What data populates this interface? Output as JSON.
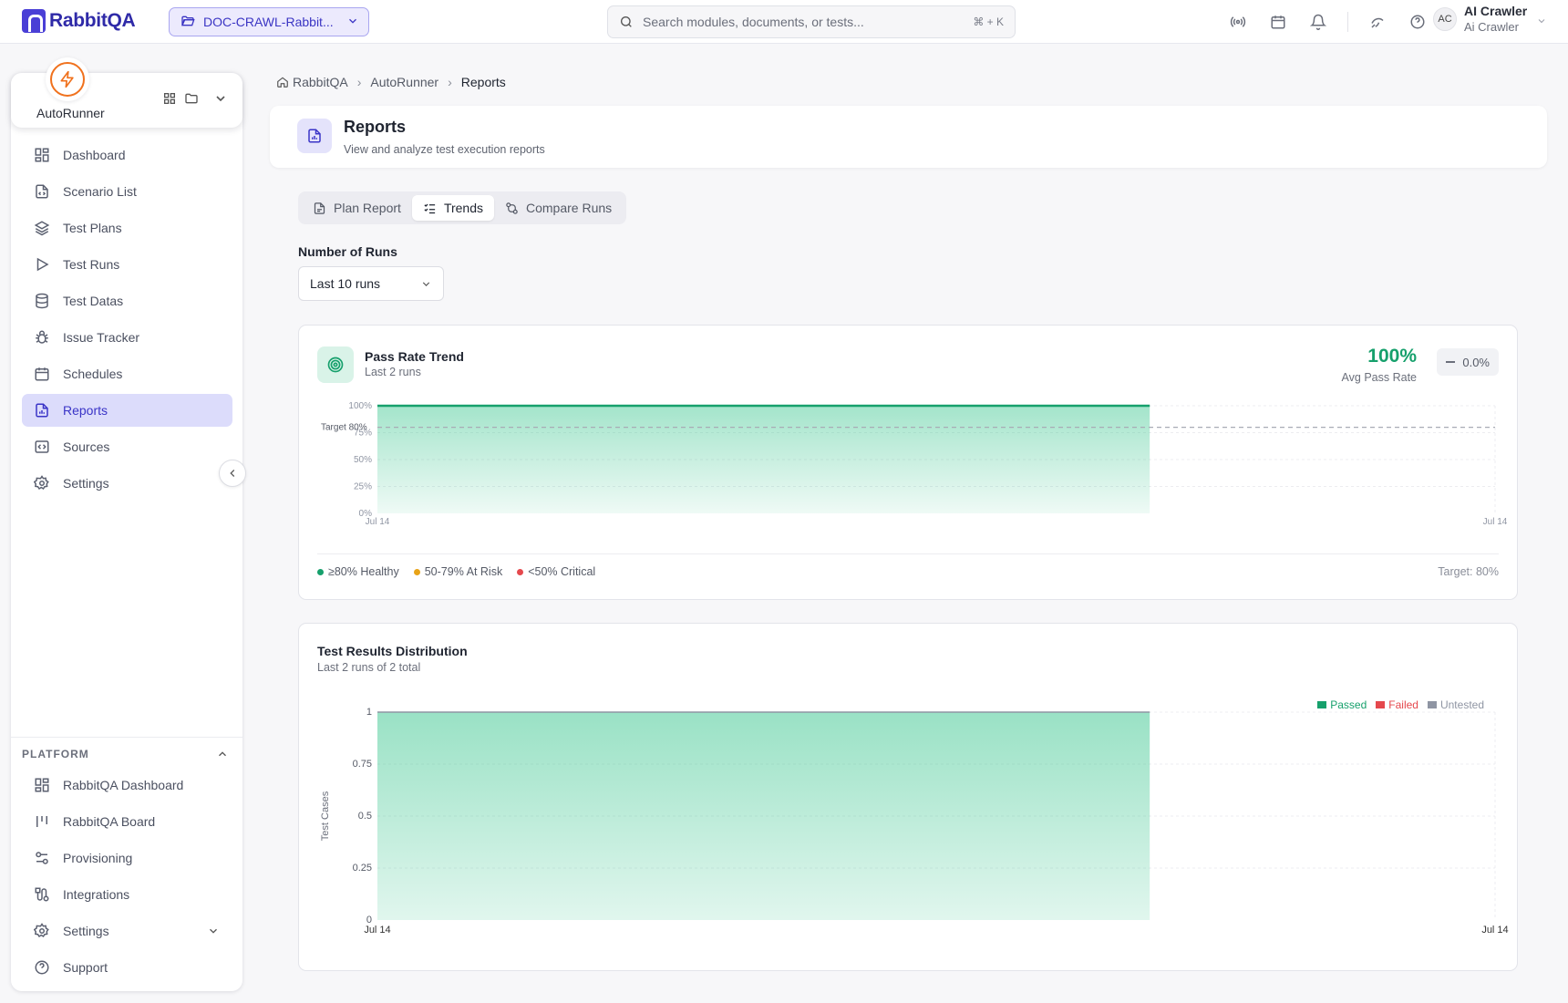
{
  "app": {
    "brand": "RabbitQA",
    "project": "DOC-CRAWL-Rabbit..."
  },
  "search": {
    "placeholder": "Search modules, documents, or tests...",
    "shortcut": "⌘ + K"
  },
  "user": {
    "initials": "AC",
    "name": "AI Crawler",
    "subtitle": "Ai Crawler"
  },
  "sidebar": {
    "app_name": "AutoRunner",
    "items": [
      {
        "label": "Dashboard",
        "icon": "dashboard-icon"
      },
      {
        "label": "Scenario List",
        "icon": "file-code-icon"
      },
      {
        "label": "Test Plans",
        "icon": "layers-icon"
      },
      {
        "label": "Test Runs",
        "icon": "play-icon"
      },
      {
        "label": "Test Datas",
        "icon": "database-icon"
      },
      {
        "label": "Issue Tracker",
        "icon": "bug-icon"
      },
      {
        "label": "Schedules",
        "icon": "calendar-icon"
      },
      {
        "label": "Reports",
        "icon": "report-icon",
        "active": true
      },
      {
        "label": "Sources",
        "icon": "code-icon"
      },
      {
        "label": "Settings",
        "icon": "gear-icon"
      }
    ],
    "platform_heading": "PLATFORM",
    "platform_items": [
      {
        "label": "RabbitQA Dashboard",
        "icon": "dashboard-icon"
      },
      {
        "label": "RabbitQA Board",
        "icon": "board-icon"
      },
      {
        "label": "Provisioning",
        "icon": "sliders-icon"
      },
      {
        "label": "Integrations",
        "icon": "integration-icon"
      },
      {
        "label": "Settings",
        "icon": "gear-icon",
        "expandable": true
      },
      {
        "label": "Support",
        "icon": "help-icon"
      }
    ]
  },
  "breadcrumb": [
    "RabbitQA",
    "AutoRunner",
    "Reports"
  ],
  "header": {
    "title": "Reports",
    "subtitle": "View and analyze test execution reports"
  },
  "tabs": [
    {
      "label": "Plan Report",
      "icon": "file-icon"
    },
    {
      "label": "Trends",
      "icon": "list-check-icon",
      "active": true
    },
    {
      "label": "Compare Runs",
      "icon": "compare-icon"
    }
  ],
  "runs_filter": {
    "label": "Number of Runs",
    "value": "Last 10 runs"
  },
  "colors": {
    "accent": "#3a34c7",
    "healthy": "#16a06c",
    "at_risk": "#e8a317",
    "critical": "#e5484d",
    "untested": "#8f95a3"
  },
  "pass_rate": {
    "title": "Pass Rate Trend",
    "subtitle": "Last 2 runs",
    "avg_value": "100%",
    "avg_label": "Avg Pass Rate",
    "delta": "0.0%",
    "target_line_label": "Target 80%",
    "legend": [
      {
        "label": "≥80% Healthy",
        "color": "#16a06c"
      },
      {
        "label": "50-79% At Risk",
        "color": "#e8a317"
      },
      {
        "label": "<50% Critical",
        "color": "#e5484d"
      }
    ],
    "target_note": "Target: 80%"
  },
  "distribution": {
    "title": "Test Results Distribution",
    "subtitle": "Last 2 runs of 2 total",
    "legend": [
      {
        "label": "Passed",
        "color": "#16a06c"
      },
      {
        "label": "Failed",
        "color": "#e5484d"
      },
      {
        "label": "Untested",
        "color": "#8f95a3"
      }
    ]
  },
  "chart_data": [
    {
      "type": "area",
      "title": "Pass Rate Trend",
      "x": [
        "Jul 14",
        "Jul 14"
      ],
      "series": [
        {
          "values": [
            100,
            100
          ]
        }
      ],
      "y_ticks": [
        "0%",
        "25%",
        "50%",
        "75%",
        "100%"
      ],
      "ylim": [
        0,
        100
      ],
      "target": 80,
      "grid": true
    },
    {
      "type": "area",
      "title": "Test Results Distribution",
      "x": [
        "Jul 14",
        "Jul 14"
      ],
      "ylabel": "Test Cases",
      "series": [
        {
          "name": "Passed",
          "values": [
            1,
            1
          ]
        },
        {
          "name": "Failed",
          "values": [
            0,
            0
          ]
        },
        {
          "name": "Untested",
          "values": [
            0,
            0
          ]
        }
      ],
      "y_ticks": [
        "0",
        "0.25",
        "0.5",
        "0.75",
        "1"
      ],
      "ylim": [
        0,
        1
      ],
      "legend_position": "top-right",
      "grid": true
    }
  ]
}
